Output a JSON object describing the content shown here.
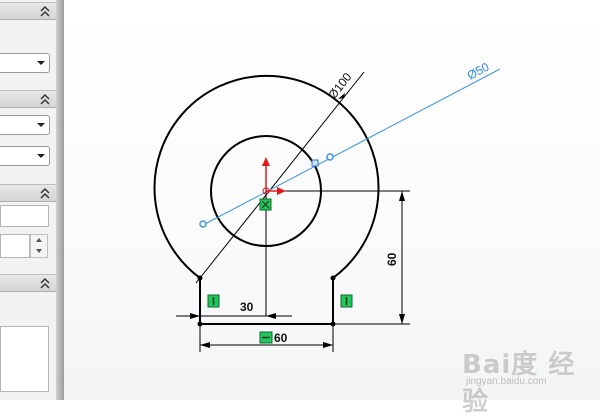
{
  "panel": {
    "sections": [
      {
        "name": "section-1",
        "collapse_icon": "double-chevron-up-icon"
      },
      {
        "name": "section-2",
        "collapse_icon": "double-chevron-up-icon"
      },
      {
        "name": "section-3",
        "collapse_icon": "double-chevron-up-icon"
      },
      {
        "name": "section-4",
        "collapse_icon": "double-chevron-up-icon"
      }
    ],
    "dropdown_icon": "chevron-down-icon",
    "spinner_icons": [
      "spinner-up-icon",
      "spinner-down-icon"
    ]
  },
  "sketch": {
    "dimensions": {
      "outer_diameter": "100",
      "inner_diameter": "50",
      "height": "60",
      "half_width": "30",
      "bottom_width": "60"
    },
    "diameter_symbol": "Ø",
    "colors": {
      "geometry": "#000000",
      "construction_line": "#3b95e8",
      "relation_badge": "#22c55e",
      "origin_arrow": "#e0191d"
    },
    "relations": [
      "vertical",
      "vertical",
      "horizontal",
      "fixed-origin"
    ]
  },
  "watermark": {
    "brand": "Bai度 经验",
    "url": "jingyan.baidu.com"
  }
}
